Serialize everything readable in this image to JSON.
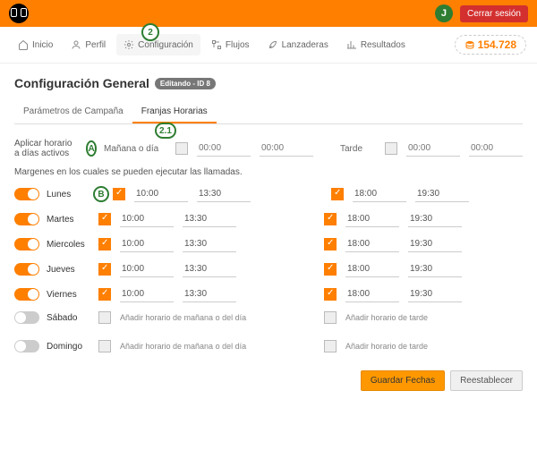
{
  "header": {
    "avatar_initial": "J",
    "logout": "Cerrar sesión"
  },
  "nav": {
    "inicio": "Inicio",
    "perfil": "Perfil",
    "config": "Configuración",
    "flujos": "Flujos",
    "lanzaderas": "Lanzaderas",
    "resultados": "Resultados",
    "balance": "154.728"
  },
  "badges": {
    "step2": "2",
    "step21": "2.1",
    "A": "A",
    "B": "B"
  },
  "page": {
    "title": "Configuración General",
    "pill": "Editando - ID 8",
    "tab_params": "Parámetros de Campaña",
    "tab_franjas": "Franjas Horarias",
    "apply_label": "Aplicar horario a días activos",
    "morning_label": "Mañana o día",
    "afternoon_label": "Tarde",
    "placeholder_time": "00:00",
    "margins_hint": "Margenes en los cuales se pueden ejecutar las llamadas.",
    "add_morning": "Añadir horario de mañana o del día",
    "add_afternoon": "Añadir horario de tarde",
    "save": "Guardar Fechas",
    "reset": "Reestablecer"
  },
  "days": {
    "lunes": {
      "on": true,
      "name": "Lunes",
      "m1": "10:00",
      "m2": "13:30",
      "t1": "18:00",
      "t2": "19:30"
    },
    "martes": {
      "on": true,
      "name": "Martes",
      "m1": "10:00",
      "m2": "13:30",
      "t1": "18:00",
      "t2": "19:30"
    },
    "miercoles": {
      "on": true,
      "name": "Miercoles",
      "m1": "10:00",
      "m2": "13:30",
      "t1": "18:00",
      "t2": "19:30"
    },
    "jueves": {
      "on": true,
      "name": "Jueves",
      "m1": "10:00",
      "m2": "13:30",
      "t1": "18:00",
      "t2": "19:30"
    },
    "viernes": {
      "on": true,
      "name": "Viernes",
      "m1": "10:00",
      "m2": "13:30",
      "t1": "18:00",
      "t2": "19:30"
    },
    "sabado": {
      "on": false,
      "name": "Sábado"
    },
    "domingo": {
      "on": false,
      "name": "Domingo"
    }
  }
}
